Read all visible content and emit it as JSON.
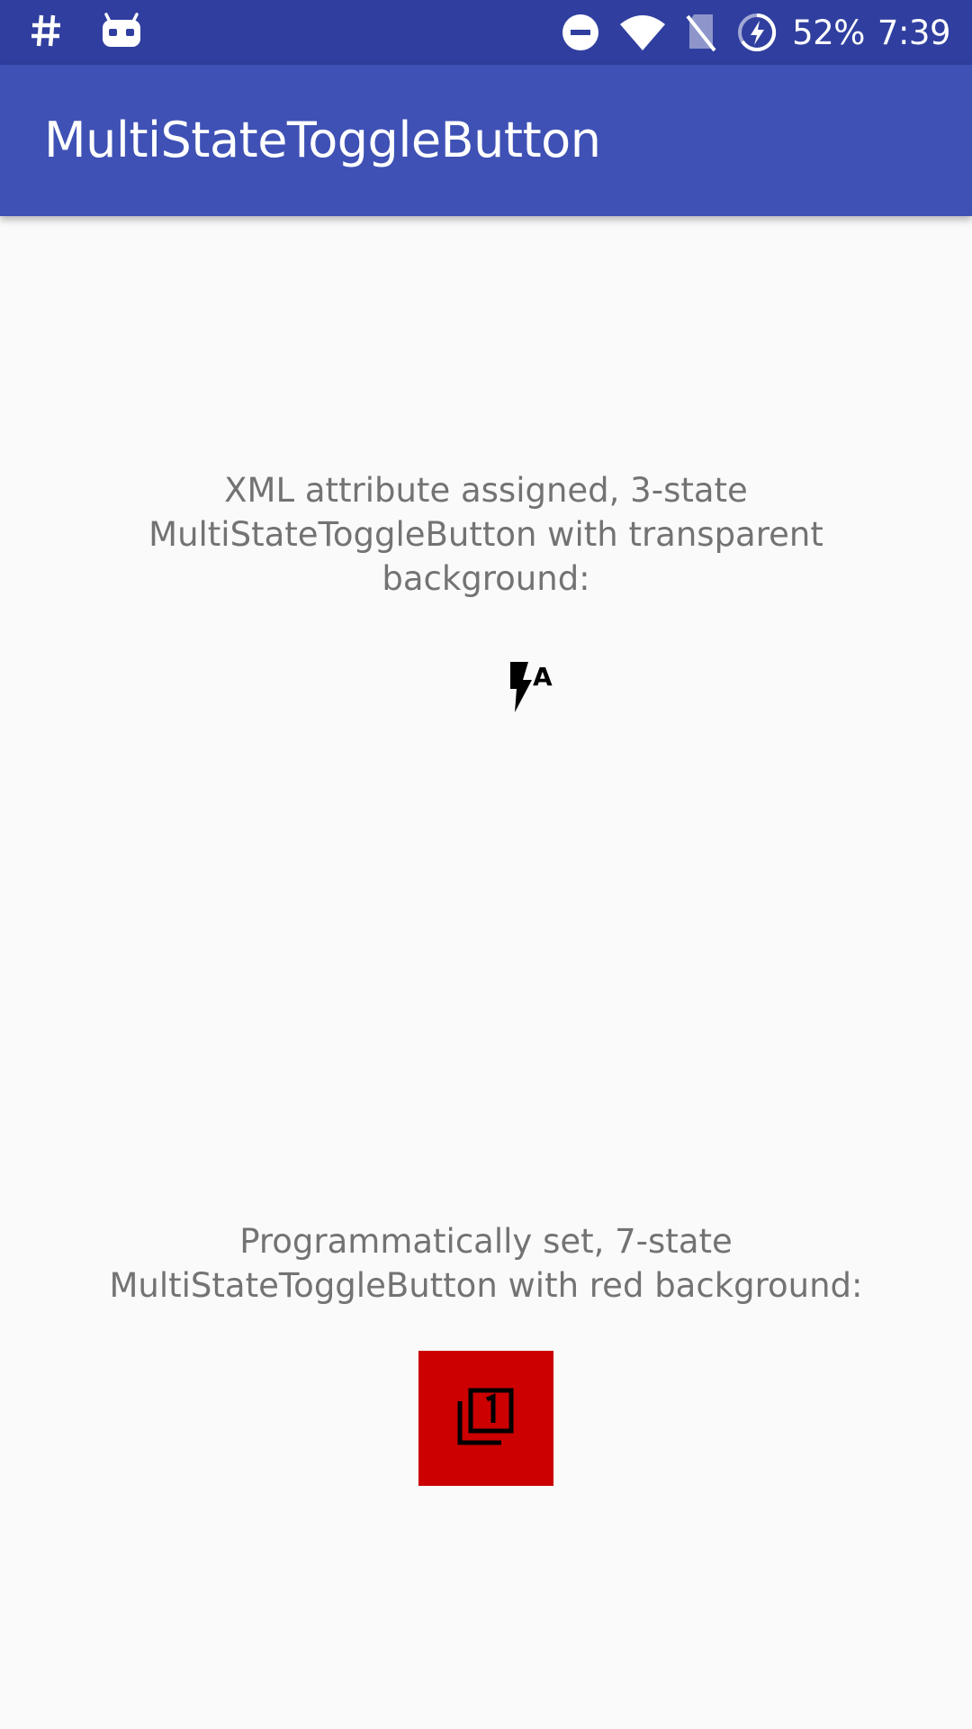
{
  "status_bar": {
    "battery": "52%",
    "time": "7:39",
    "icons": [
      "hash-icon",
      "android-icon",
      "do-not-disturb-icon",
      "wifi-icon",
      "no-sim-icon",
      "battery-charging-icon"
    ]
  },
  "app_bar": {
    "title": "MultiStateToggleButton"
  },
  "main": {
    "caption_1": "XML attribute assigned, 3-state MultiStateToggleButton with transparent background:",
    "toggle_1_icon": "flash-auto-icon",
    "caption_2": "Programmatically set, 7-state MultiStateToggleButton with red background:",
    "toggle_2_icon": "filter-1-icon",
    "toggle_2_background": "#cc0000"
  },
  "colors": {
    "status_bar": "#303f9f",
    "app_bar": "#3f51b5",
    "background": "#fafafa",
    "caption_text": "#737373"
  }
}
